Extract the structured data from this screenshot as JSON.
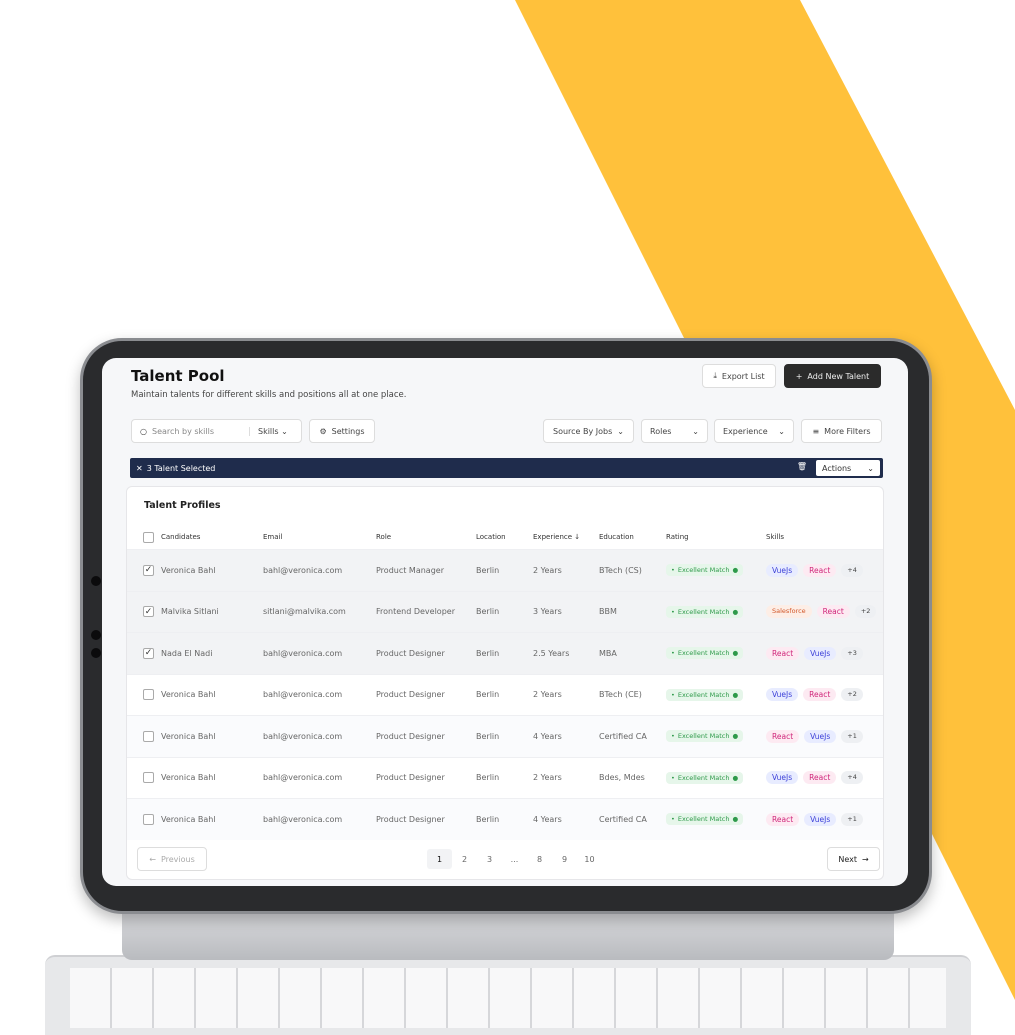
{
  "colors": {
    "band": "#FFC13B",
    "selection_bar": "#1f2c4c",
    "primary_button": "#2b2b2b",
    "match": "#2e9a4a"
  },
  "header": {
    "title": "Talent Pool",
    "subtitle": "Maintain talents for different skills and positions all at one place.",
    "export_label": "Export List",
    "add_label": "Add New Talent"
  },
  "filters": {
    "search_placeholder": "Search by skills",
    "skills": "Skills",
    "settings": "Settings",
    "source": "Source By Jobs",
    "roles": "Roles",
    "experience": "Experience",
    "more": "More Filters"
  },
  "selection": {
    "text": "3 Talent Selected",
    "actions": "Actions"
  },
  "table": {
    "title": "Talent Profiles",
    "columns": [
      "Candidates",
      "Email",
      "Role",
      "Location",
      "Experience",
      "Education",
      "Rating",
      "Skills"
    ],
    "sort_icon": "arrow-down-icon",
    "rows": [
      {
        "checked": true,
        "name": "Veronica Bahl",
        "email": "bahl@veronica.com",
        "role": "Product Manager",
        "location": "Berlin",
        "experience": "2 Years",
        "education": "BTech (CS)",
        "rating": "Excellent Match",
        "skills": [
          "VueJs",
          "React"
        ],
        "more": "+4"
      },
      {
        "checked": true,
        "name": "Malvika Sitlani",
        "email": "sitlani@malvika.com",
        "role": "Frontend Developer",
        "location": "Berlin",
        "experience": "3 Years",
        "education": "BBM",
        "rating": "Excellent Match",
        "skills": [
          "Salesforce",
          "React"
        ],
        "more": "+2"
      },
      {
        "checked": true,
        "name": "Nada El Nadi",
        "email": "bahl@veronica.com",
        "role": "Product Designer",
        "location": "Berlin",
        "experience": "2.5 Years",
        "education": "MBA",
        "rating": "Excellent Match",
        "skills": [
          "React",
          "VueJs"
        ],
        "more": "+3"
      },
      {
        "checked": false,
        "name": "Veronica Bahl",
        "email": "bahl@veronica.com",
        "role": "Product Designer",
        "location": "Berlin",
        "experience": "2 Years",
        "education": "BTech (CE)",
        "rating": "Excellent Match",
        "skills": [
          "VueJs",
          "React"
        ],
        "more": "+2"
      },
      {
        "checked": false,
        "name": "Veronica Bahl",
        "email": "bahl@veronica.com",
        "role": "Product Designer",
        "location": "Berlin",
        "experience": "4 Years",
        "education": "Certified CA",
        "rating": "Excellent Match",
        "skills": [
          "React",
          "VueJs"
        ],
        "more": "+1"
      },
      {
        "checked": false,
        "name": "Veronica Bahl",
        "email": "bahl@veronica.com",
        "role": "Product Designer",
        "location": "Berlin",
        "experience": "2 Years",
        "education": "Bdes, Mdes",
        "rating": "Excellent Match",
        "skills": [
          "VueJs",
          "React"
        ],
        "more": "+4"
      },
      {
        "checked": false,
        "name": "Veronica Bahl",
        "email": "bahl@veronica.com",
        "role": "Product Designer",
        "location": "Berlin",
        "experience": "4 Years",
        "education": "Certified CA",
        "rating": "Excellent Match",
        "skills": [
          "React",
          "VueJs"
        ],
        "more": "+1"
      }
    ]
  },
  "pagination": {
    "previous": "Previous",
    "next": "Next",
    "pages": [
      "1",
      "2",
      "3",
      "...",
      "8",
      "9",
      "10"
    ],
    "current": "1"
  }
}
